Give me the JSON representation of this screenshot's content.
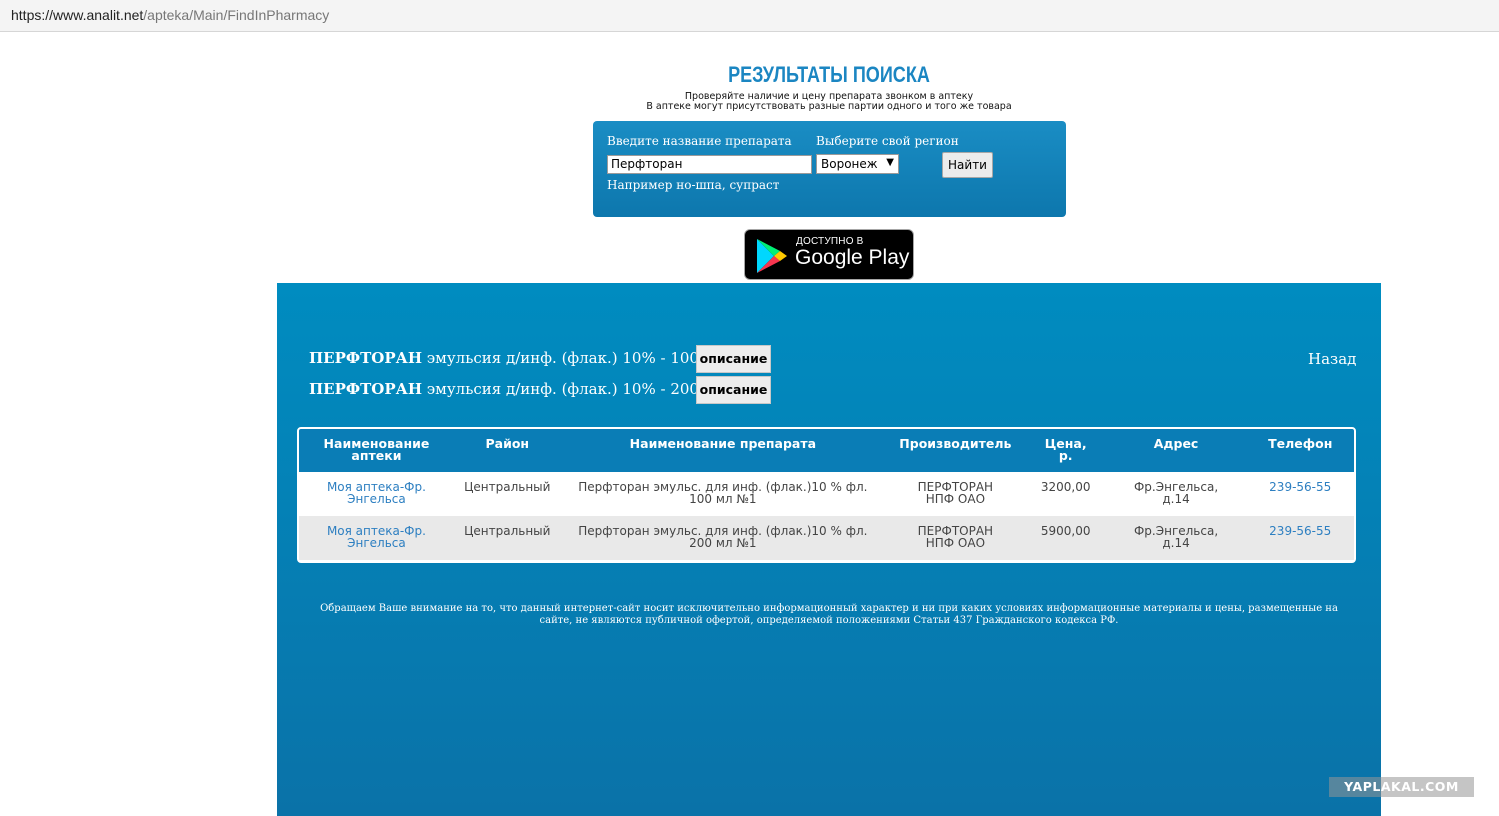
{
  "browser": {
    "url_host": "https://www.analit.net",
    "url_path": "/apteka/Main/FindInPharmacy"
  },
  "header": {
    "title": "РЕЗУЛЬТАТЫ ПОИСКА",
    "subtitle_1": "Проверяйте наличие и цену препарата звонком в аптеку",
    "subtitle_2": "В аптеке могут присутствовать разные партии одного и того же товара"
  },
  "search": {
    "drug_label": "Введите название препарата",
    "drug_value": "Перфторан",
    "region_label": "Выберите свой регион",
    "region_value": "Воронеж",
    "example": "Например но-шпа, супраст",
    "find_label": "Найти"
  },
  "google_play": {
    "small_text": "ДОСТУПНО В",
    "big_text": "Google Play",
    "colors": [
      "#00d7fe",
      "#00f076",
      "#ffc900",
      "#f7354f"
    ]
  },
  "products": [
    {
      "name": "ПЕРФТОРАН",
      "details": " эмульсия д/инф. (флак.) 10% - 100 мл N1",
      "button": "описание"
    },
    {
      "name": "ПЕРФТОРАН",
      "details": " эмульсия д/инф. (флак.) 10% - 200 мл N1",
      "button": "описание"
    }
  ],
  "back_label": "Назад",
  "table": {
    "headers": [
      "Наименование аптеки",
      "Район",
      "Наименование препарата",
      "Производитель",
      "Цена, р.",
      "Адрес",
      "Телефон"
    ],
    "rows": [
      [
        "Моя аптека-Фр. Энгельса",
        "Центральный",
        "Перфторан эмульс. для инф. (флак.)10 % фл. 100 мл №1",
        "ПЕРФТОРАН НПФ ОАО",
        "3200,00",
        "Фр.Энгельса, д.14",
        "239-56-55"
      ],
      [
        "Моя аптека-Фр. Энгельса",
        "Центральный",
        "Перфторан эмульс. для инф. (флак.)10 % фл. 200 мл №1",
        "ПЕРФТОРАН НПФ ОАО",
        "5900,00",
        "Фр.Энгельса, д.14",
        "239-56-55"
      ]
    ]
  },
  "disclaimer": "Обращаем Ваше внимание на то, что данный интернет-сайт носит исключительно информационный характер и ни при каких условиях информационные материалы и цены, размещенные на сайте, не являются публичной офертой, определяемой положениями Статьи 437 Гражданского кодекса РФ.",
  "watermark": "YAPLAKAL.COM",
  "colors": {
    "title": "#1b86c2",
    "panel": "#008cc0",
    "link": "#2d7fc1"
  }
}
